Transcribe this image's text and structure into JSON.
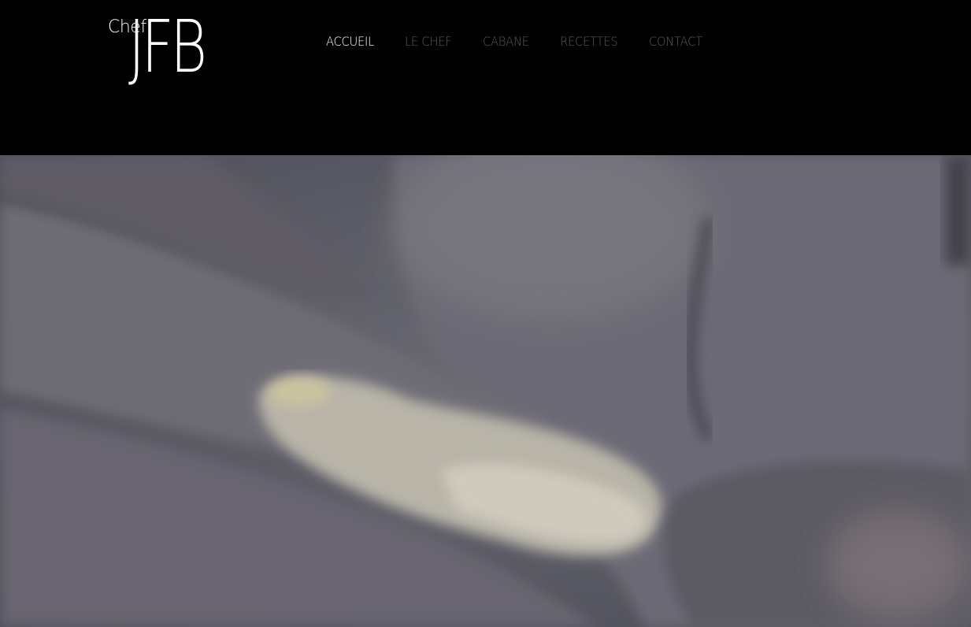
{
  "logo": {
    "small": "Chef",
    "big": "JFB"
  },
  "nav": {
    "items": [
      {
        "label": "ACCUEIL",
        "active": true
      },
      {
        "label": "LE CHEF",
        "active": false
      },
      {
        "label": "CABANE",
        "active": false
      },
      {
        "label": "RECETTES",
        "active": false
      },
      {
        "label": "CONTACT",
        "active": false
      }
    ]
  },
  "colors": {
    "header_bg": "#000000",
    "nav_active": "#ffffff",
    "nav_inactive": "#5a5a5a",
    "hero_tone": "#5a5b66"
  }
}
